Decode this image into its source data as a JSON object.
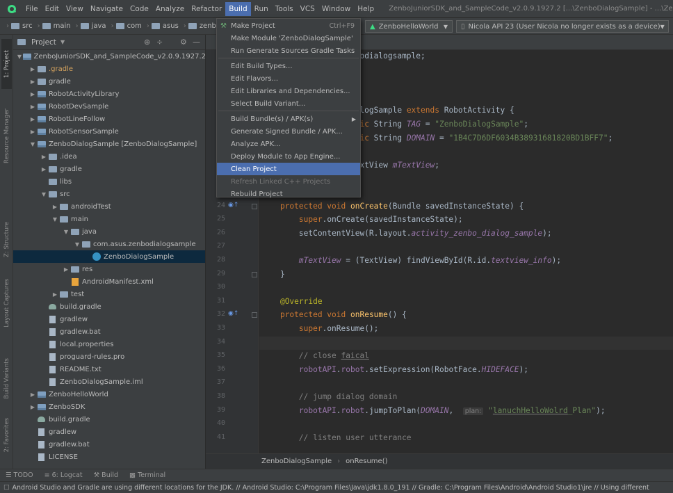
{
  "menubar": {
    "items": [
      "File",
      "Edit",
      "View",
      "Navigate",
      "Code",
      "Analyze",
      "Refactor",
      "Build",
      "Run",
      "Tools",
      "VCS",
      "Window",
      "Help"
    ],
    "active": "Build",
    "window_title": "ZenboJuniorSDK_and_SampleCode_v2.0.9.1927.2 [...\\ZenboDialogSample] - ...\\ZenboDi"
  },
  "navbar": {
    "crumbs": [
      "src",
      "main",
      "java",
      "com",
      "asus",
      "zenbodial"
    ],
    "run_config": "ZenboHelloWorld",
    "device": "Nicola API 23 (User Nicola no longer exists as a device)"
  },
  "leftstrip": {
    "tabs": [
      "1: Project",
      "Resource Manager",
      "Z: Structure",
      "Layout Captures",
      "Build Variants",
      "2: Favorites"
    ]
  },
  "project_panel": {
    "title": "Project",
    "tree": [
      {
        "label": "ZenboJuniorSDK_and_SampleCode_v2.0.9.1927.2",
        "depth": 0,
        "arrow": "down",
        "icon": "module"
      },
      {
        "label": ".gradle",
        "depth": 1,
        "arrow": "right",
        "icon": "folder",
        "hl": true
      },
      {
        "label": "gradle",
        "depth": 1,
        "arrow": "right",
        "icon": "folder"
      },
      {
        "label": "RobotActivityLibrary",
        "depth": 1,
        "arrow": "right",
        "icon": "module"
      },
      {
        "label": "RobotDevSample",
        "depth": 1,
        "arrow": "right",
        "icon": "module"
      },
      {
        "label": "RobotLineFollow",
        "depth": 1,
        "arrow": "right",
        "icon": "module"
      },
      {
        "label": "RobotSensorSample",
        "depth": 1,
        "arrow": "right",
        "icon": "module"
      },
      {
        "label": "ZenboDialogSample [ZenboDialogSample]",
        "depth": 1,
        "arrow": "down",
        "icon": "module"
      },
      {
        "label": ".idea",
        "depth": 2,
        "arrow": "right",
        "icon": "folder"
      },
      {
        "label": "gradle",
        "depth": 2,
        "arrow": "right",
        "icon": "folder"
      },
      {
        "label": "libs",
        "depth": 2,
        "arrow": "",
        "icon": "folder"
      },
      {
        "label": "src",
        "depth": 2,
        "arrow": "down",
        "icon": "folder"
      },
      {
        "label": "androidTest",
        "depth": 3,
        "arrow": "right",
        "icon": "folder"
      },
      {
        "label": "main",
        "depth": 3,
        "arrow": "down",
        "icon": "folder"
      },
      {
        "label": "java",
        "depth": 4,
        "arrow": "down",
        "icon": "folder"
      },
      {
        "label": "com.asus.zenbodialogsample",
        "depth": 5,
        "arrow": "down",
        "icon": "folder"
      },
      {
        "label": "ZenboDialogSample",
        "depth": 6,
        "arrow": "",
        "icon": "classc",
        "selected": true
      },
      {
        "label": "res",
        "depth": 4,
        "arrow": "right",
        "icon": "folder"
      },
      {
        "label": "AndroidManifest.xml",
        "depth": 4,
        "arrow": "",
        "icon": "xml"
      },
      {
        "label": "test",
        "depth": 3,
        "arrow": "right",
        "icon": "folder"
      },
      {
        "label": "build.gradle",
        "depth": 2,
        "arrow": "",
        "icon": "gradle"
      },
      {
        "label": "gradlew",
        "depth": 2,
        "arrow": "",
        "icon": "file"
      },
      {
        "label": "gradlew.bat",
        "depth": 2,
        "arrow": "",
        "icon": "file"
      },
      {
        "label": "local.properties",
        "depth": 2,
        "arrow": "",
        "icon": "file"
      },
      {
        "label": "proguard-rules.pro",
        "depth": 2,
        "arrow": "",
        "icon": "file"
      },
      {
        "label": "README.txt",
        "depth": 2,
        "arrow": "",
        "icon": "file"
      },
      {
        "label": "ZenboDialogSample.iml",
        "depth": 2,
        "arrow": "",
        "icon": "file"
      },
      {
        "label": "ZenboHelloWorld",
        "depth": 1,
        "arrow": "right",
        "icon": "module"
      },
      {
        "label": "ZenboSDK",
        "depth": 1,
        "arrow": "right",
        "icon": "module"
      },
      {
        "label": "build.gradle",
        "depth": 1,
        "arrow": "",
        "icon": "gradle"
      },
      {
        "label": "gradlew",
        "depth": 1,
        "arrow": "",
        "icon": "file"
      },
      {
        "label": "gradlew.bat",
        "depth": 1,
        "arrow": "",
        "icon": "file"
      },
      {
        "label": "LICENSE",
        "depth": 1,
        "arrow": "",
        "icon": "file"
      }
    ]
  },
  "build_menu": {
    "items": [
      {
        "label": "Make Project",
        "shortcut": "Ctrl+F9"
      },
      {
        "label": "Make Module 'ZenboDialogSample'"
      },
      {
        "label": "Run Generate Sources Gradle Tasks"
      },
      {
        "sep": true
      },
      {
        "label": "Edit Build Types..."
      },
      {
        "label": "Edit Flavors..."
      },
      {
        "label": "Edit Libraries and Dependencies..."
      },
      {
        "label": "Select Build Variant..."
      },
      {
        "sep": true
      },
      {
        "label": "Build Bundle(s) / APK(s)",
        "submenu": true
      },
      {
        "label": "Generate Signed Bundle / APK..."
      },
      {
        "label": "Analyze APK..."
      },
      {
        "label": "Deploy Module to App Engine..."
      },
      {
        "label": "Clean Project",
        "hover": true
      },
      {
        "label": "Refresh Linked C++ Projects",
        "disabled": true
      },
      {
        "label": "Rebuild Project"
      }
    ]
  },
  "editor": {
    "lines": [
      {
        "n": "",
        "html": "<span class=\"kw\">package</span> com.asus.zenbodialogsample;"
      },
      {
        "n": "",
        "html": ""
      },
      {
        "n": "",
        "html": "<span class=\"kw\">import</span> ..."
      },
      {
        "n": "",
        "html": ""
      },
      {
        "n": "",
        "html": "<span class=\"kw\">public class</span> ZenboDialogSample <span class=\"kw\">extends</span> RobotActivity {"
      },
      {
        "n": "",
        "html": "    <span class=\"kw\">public final static</span> String <span class=\"fld\">TAG</span> = <span class=\"str\">\"ZenboDialogSample\"</span>;"
      },
      {
        "n": "",
        "html": "    <span class=\"kw\">public final static</span> String <span class=\"fld\">DOMAIN</span> = <span class=\"str\">\"1B4C7D6DF6034B38931681820BD1BFF7\"</span>;"
      },
      {
        "n": "",
        "html": ""
      },
      {
        "n": "",
        "html": "    <span class=\"kw\">private static</span> TextView <span class=\"fld\">mTextView</span>;"
      },
      {
        "n": "",
        "html": ""
      },
      {
        "n": "",
        "html": "    <span class=\"ann\">@Override</span>"
      },
      {
        "n": "24",
        "html": "    <span class=\"kw\">protected void</span> <span class=\"fn\">onCreate</span>(Bundle savedInstanceState) {",
        "gi": "o",
        "fold": true
      },
      {
        "n": "25",
        "html": "        <span class=\"kw\">super</span>.onCreate(savedInstanceState);"
      },
      {
        "n": "26",
        "html": "        setContentView(R.layout.<span class=\"fld\">activity_zenbo_dialog_sample</span>);"
      },
      {
        "n": "27",
        "html": ""
      },
      {
        "n": "28",
        "html": "        <span class=\"fld\">mTextView</span> = (TextView) findViewById(R.id.<span class=\"fld\">textview_info</span>);"
      },
      {
        "n": "29",
        "html": "    }",
        "fold": true
      },
      {
        "n": "30",
        "html": ""
      },
      {
        "n": "31",
        "html": "    <span class=\"ann\">@Override</span>"
      },
      {
        "n": "32",
        "html": "    <span class=\"kw\">protected void</span> <span class=\"fn\">onResume</span>() {",
        "gi": "o",
        "fold": true
      },
      {
        "n": "33",
        "html": "        <span class=\"kw\">super</span>.onResume();"
      },
      {
        "n": "34",
        "html": "",
        "current": true
      },
      {
        "n": "35",
        "html": "        <span class=\"cm\">// close <span class=\"under\">faical</span></span>"
      },
      {
        "n": "36",
        "html": "        <span class=\"fld\" style=\"font-style:normal\">robotAPI</span>.<span class=\"fld\" style=\"font-style:normal\">robot</span>.setExpression(RobotFace.<span class=\"fld\">HIDEFACE</span>);"
      },
      {
        "n": "37",
        "html": ""
      },
      {
        "n": "38",
        "html": "        <span class=\"cm\">// jump dialog domain</span>"
      },
      {
        "n": "39",
        "html": "        <span class=\"fld\" style=\"font-style:normal\">robotAPI</span>.<span class=\"fld\" style=\"font-style:normal\">robot</span>.jumpToPlan(<span class=\"fld\">DOMAIN</span>,  <span class=\"hint\">plan:</span> <span class=\"str\">\"<span class=\"under\">lanuchHelloWolrd</span>_Plan\"</span>);"
      },
      {
        "n": "40",
        "html": ""
      },
      {
        "n": "41",
        "html": "        <span class=\"cm\">// listen user utterance</span>"
      }
    ]
  },
  "editor_crumb": [
    "ZenboDialogSample",
    "onResume()"
  ],
  "bottom_tabs": [
    "TODO",
    "6: Logcat",
    "Build",
    "Terminal"
  ],
  "status_message": "Android Studio and Gradle are using different locations for the JDK. // Android Studio: C:\\Program Files\\Java\\jdk1.8.0_191 // Gradle: C:\\Program Files\\Android\\Android Studio1\\jre // Using different"
}
